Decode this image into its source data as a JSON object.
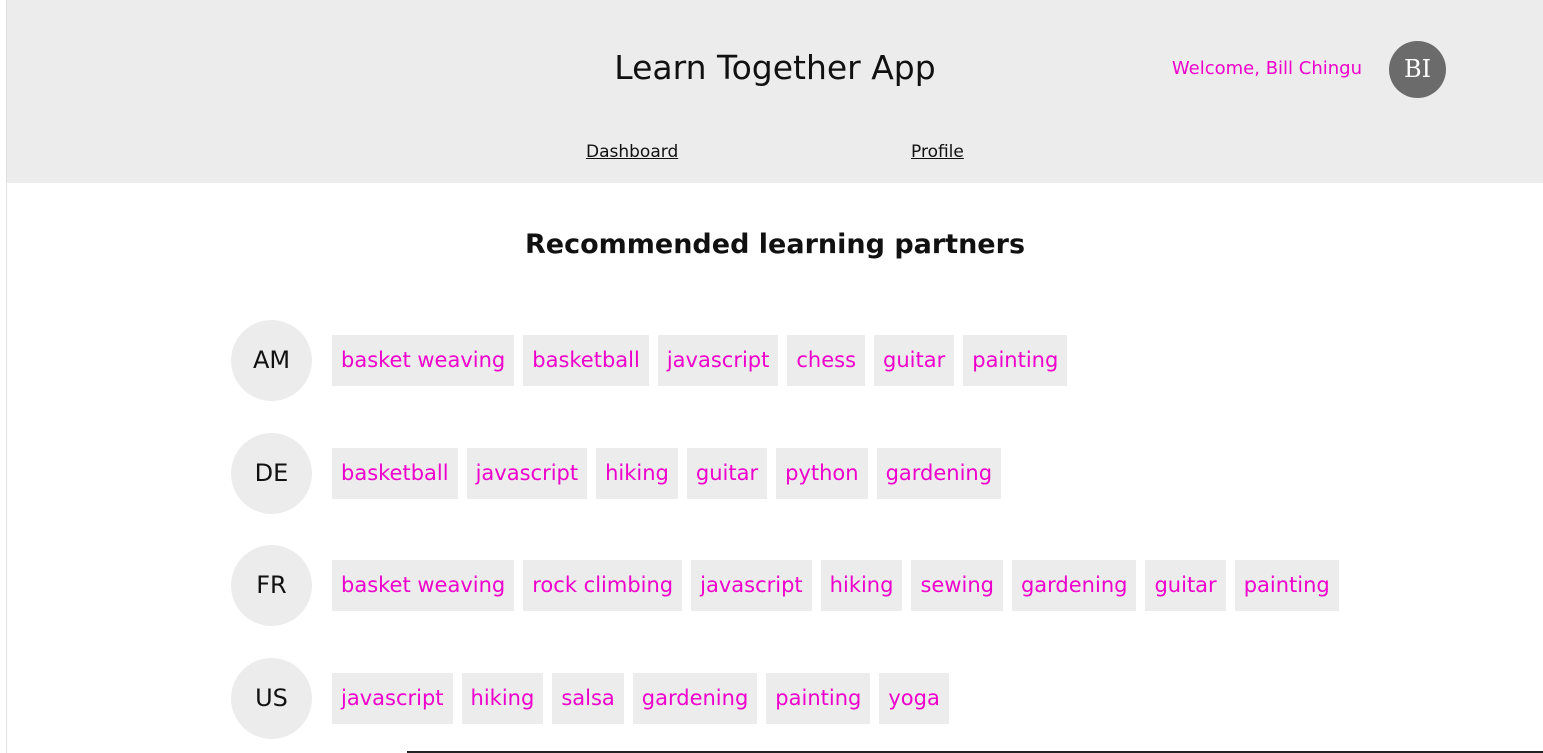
{
  "header": {
    "title": "Learn Together App",
    "welcome": "Welcome, Bill Chingu",
    "avatar_initials": "BI",
    "nav": {
      "dashboard": "Dashboard",
      "profile": "Profile"
    }
  },
  "main": {
    "section_title": "Recommended learning partners",
    "partners": [
      {
        "initials": "AM",
        "interests": [
          "basket weaving",
          "basketball",
          "javascript",
          "chess",
          "guitar",
          "painting"
        ]
      },
      {
        "initials": "DE",
        "interests": [
          "basketball",
          "javascript",
          "hiking",
          "guitar",
          "python",
          "gardening"
        ]
      },
      {
        "initials": "FR",
        "interests": [
          "basket weaving",
          "rock climbing",
          "javascript",
          "hiking",
          "sewing",
          "gardening",
          "guitar",
          "painting"
        ]
      },
      {
        "initials": "US",
        "interests": [
          "javascript",
          "hiking",
          "salsa",
          "gardening",
          "painting",
          "yoga"
        ]
      }
    ]
  },
  "colors": {
    "accent": "#ee00cc",
    "header_bg": "#ececec",
    "tag_bg": "#ececec",
    "user_avatar_bg": "#6b6b6b"
  }
}
